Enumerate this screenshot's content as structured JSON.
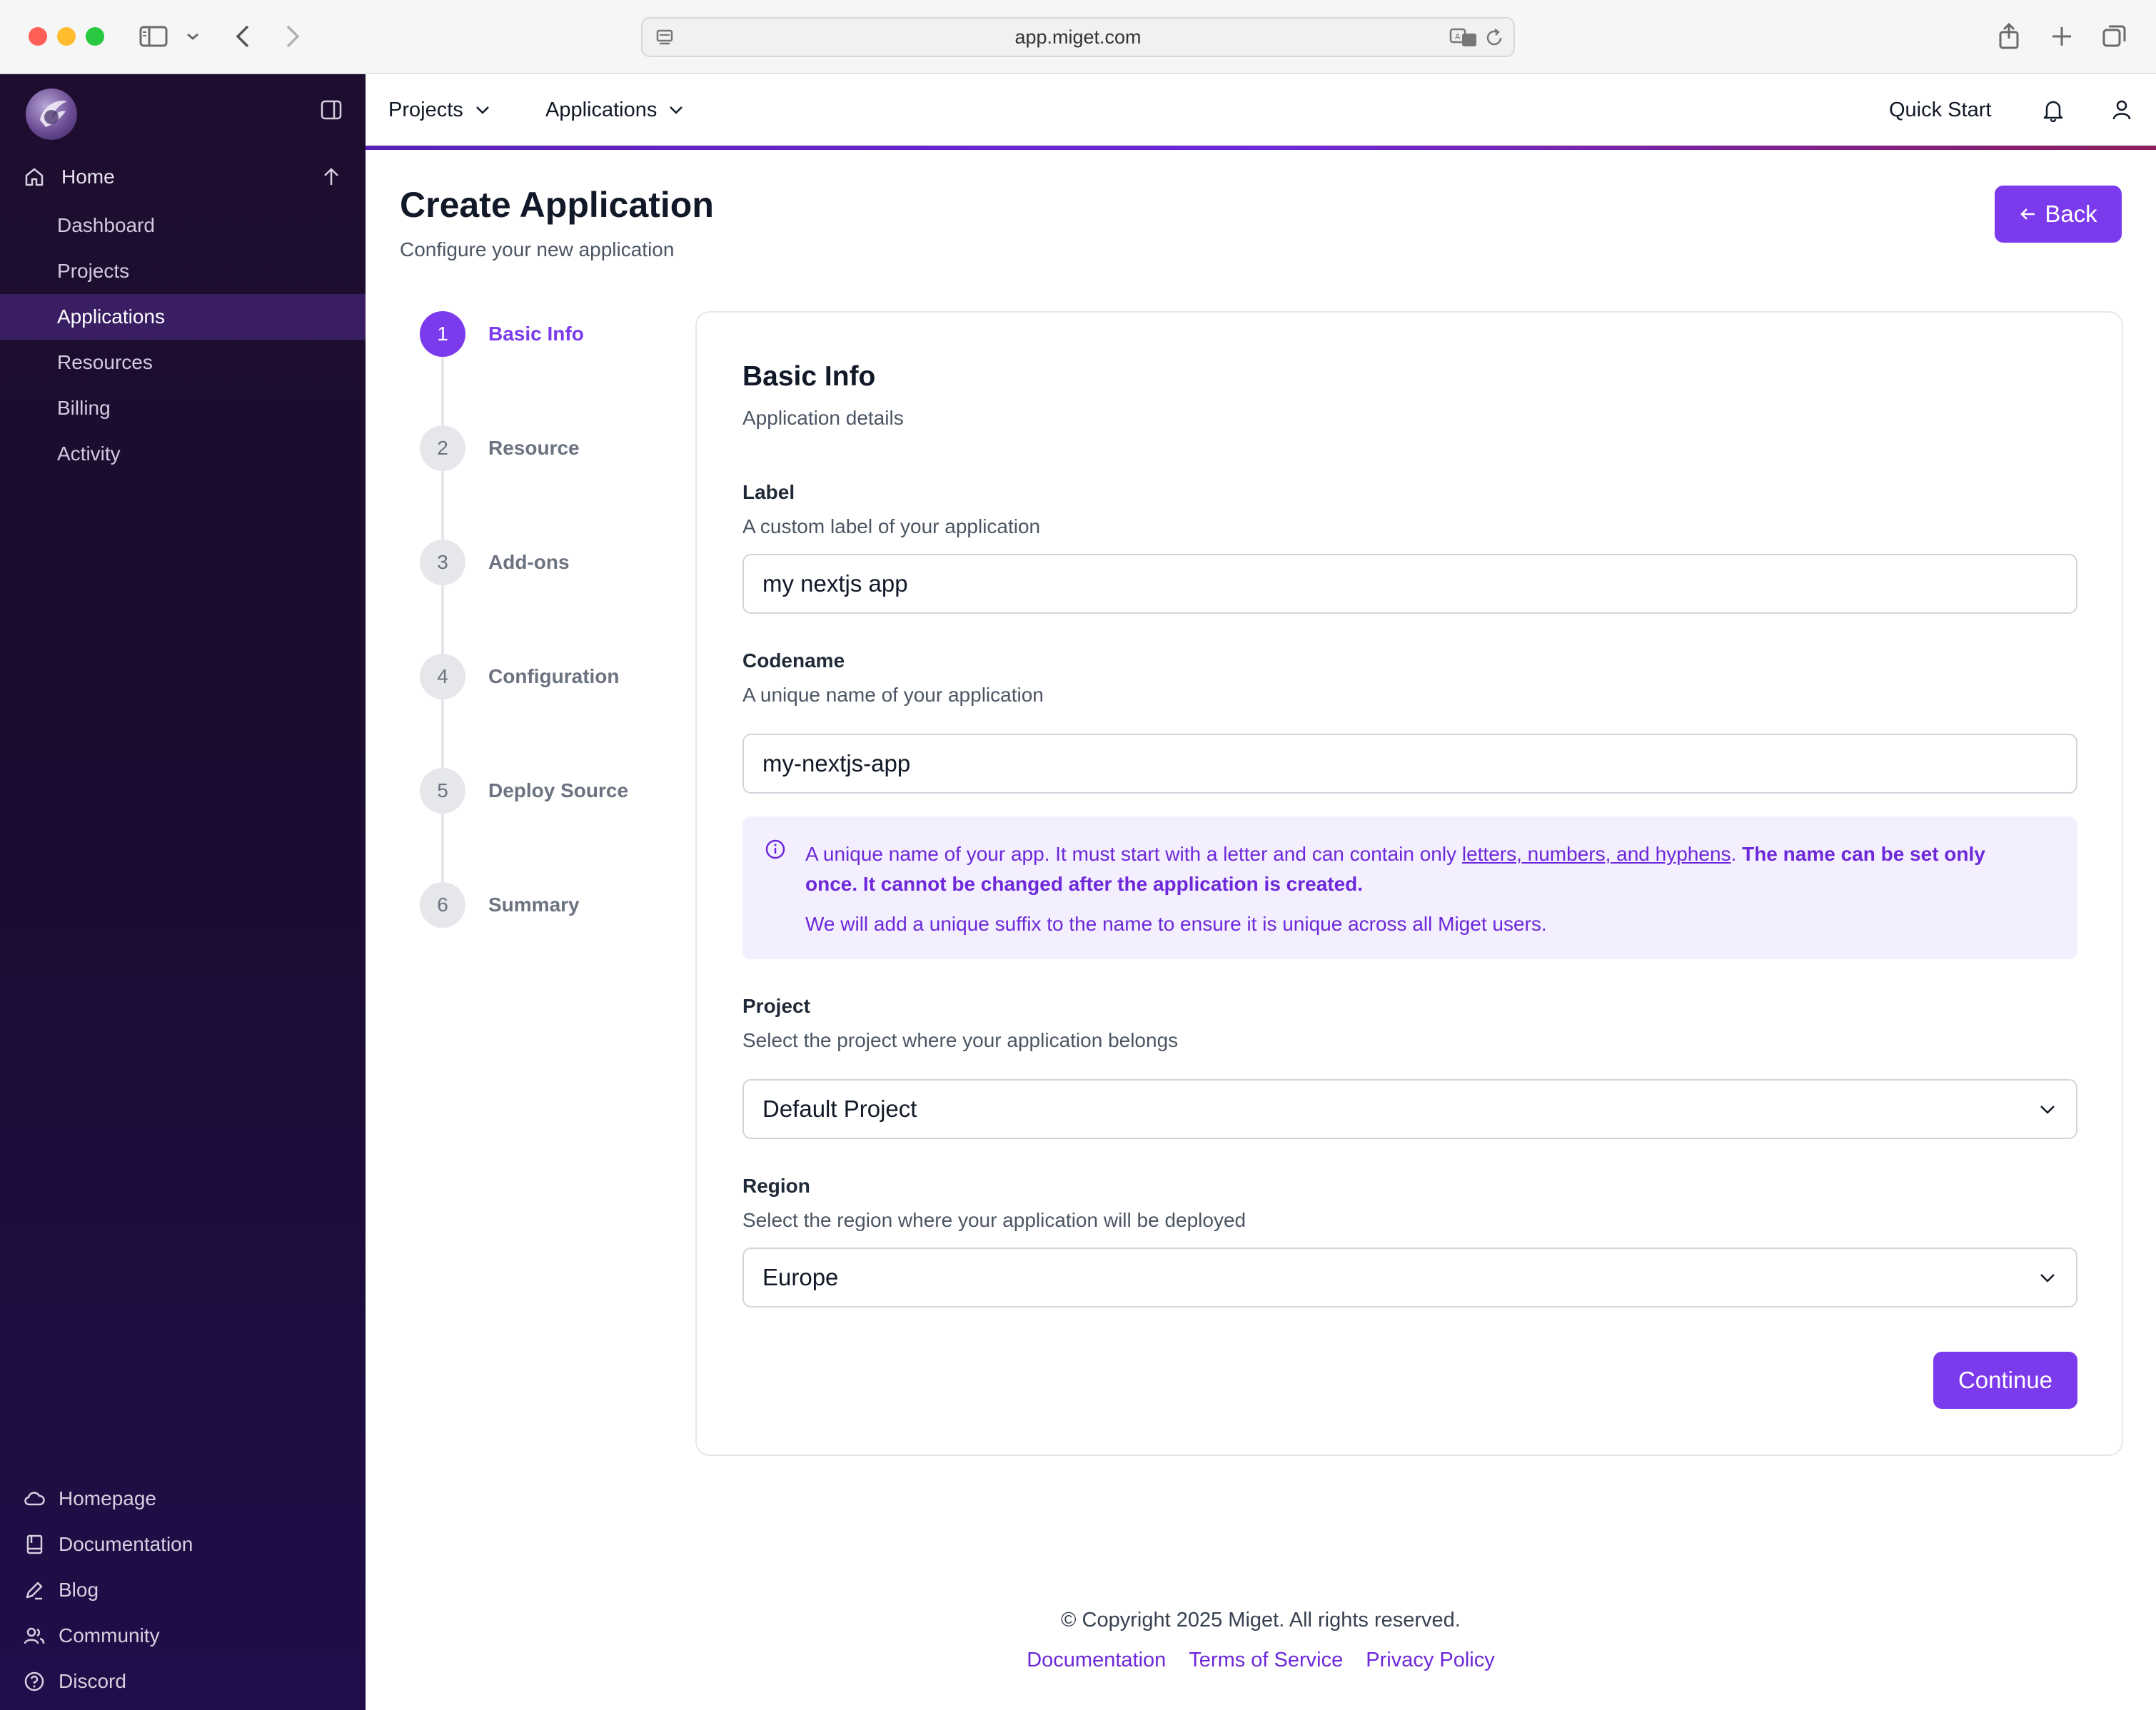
{
  "browser": {
    "url": "app.miget.com"
  },
  "sidebar": {
    "home_label": "Home",
    "items": [
      {
        "label": "Dashboard"
      },
      {
        "label": "Projects"
      },
      {
        "label": "Applications"
      },
      {
        "label": "Resources"
      },
      {
        "label": "Billing"
      },
      {
        "label": "Activity"
      }
    ],
    "active_item": "Applications",
    "footer_items": [
      {
        "label": "Homepage",
        "icon": "cloud-icon"
      },
      {
        "label": "Documentation",
        "icon": "book-icon"
      },
      {
        "label": "Blog",
        "icon": "pen-icon"
      },
      {
        "label": "Community",
        "icon": "users-icon"
      },
      {
        "label": "Discord",
        "icon": "help-circle-icon"
      }
    ]
  },
  "topbar": {
    "menus": [
      {
        "label": "Projects"
      },
      {
        "label": "Applications"
      }
    ],
    "quick_start": "Quick Start"
  },
  "page": {
    "title": "Create Application",
    "subtitle": "Configure your new application",
    "back_label": "Back"
  },
  "stepper": {
    "steps": [
      {
        "number": "1",
        "label": "Basic Info"
      },
      {
        "number": "2",
        "label": "Resource"
      },
      {
        "number": "3",
        "label": "Add-ons"
      },
      {
        "number": "4",
        "label": "Configuration"
      },
      {
        "number": "5",
        "label": "Deploy Source"
      },
      {
        "number": "6",
        "label": "Summary"
      }
    ],
    "active_step": 1
  },
  "form": {
    "title": "Basic Info",
    "subtitle": "Application details",
    "label_field": {
      "label": "Label",
      "help": "A custom label of your application",
      "value": "my nextjs app"
    },
    "codename_field": {
      "label": "Codename",
      "help": "A unique name of your application",
      "value": "my-nextjs-app"
    },
    "info": {
      "text_before": "A unique name of your app. It must start with a letter and can contain only ",
      "link_text": "letters, numbers, and hyphens",
      "text_after": ". ",
      "bold_text": "The name can be set only once. It cannot be changed after the application is created.",
      "line2": "We will add a unique suffix to the name to ensure it is unique across all Miget users."
    },
    "project_field": {
      "label": "Project",
      "help": "Select the project where your application belongs",
      "value": "Default Project"
    },
    "region_field": {
      "label": "Region",
      "help": "Select the region where your application will be deployed",
      "value": "Europe"
    },
    "continue_label": "Continue"
  },
  "footer": {
    "copyright": "© Copyright 2025 Miget. All rights reserved.",
    "links": [
      {
        "label": "Documentation"
      },
      {
        "label": "Terms of Service"
      },
      {
        "label": "Privacy Policy"
      }
    ]
  },
  "colors": {
    "accent": "#7c3aed",
    "sidebar_bg": "#1e0d2e",
    "sidebar_active": "#3a1e63",
    "info_bg": "#f3efff"
  }
}
